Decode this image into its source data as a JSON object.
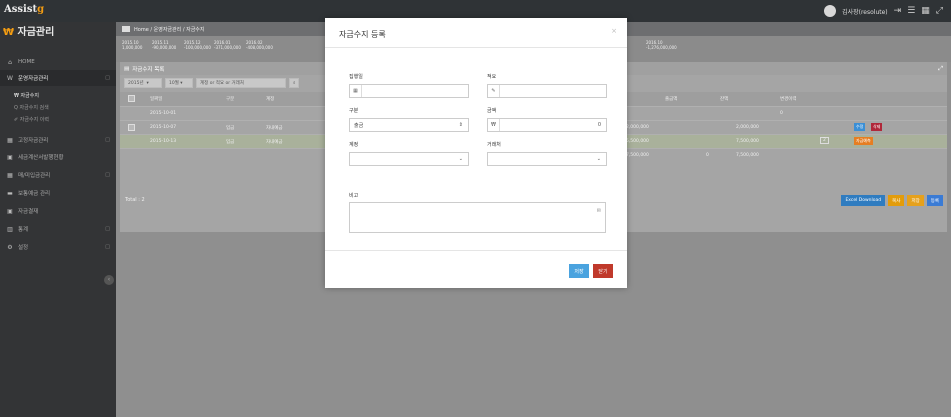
{
  "app": {
    "logo_main": "Assist",
    "logo_accent": "g",
    "user": "김사장(resolute)"
  },
  "sidebar": {
    "title_icon": "₩",
    "title": "자금관리",
    "items": [
      {
        "icon": "home-icon",
        "label": "HOME"
      },
      {
        "icon": "won-icon",
        "label": "운영자금관리",
        "arrow": "□"
      },
      {
        "icon": "calendar-icon",
        "label": "고정자금관리",
        "arrow": "□"
      },
      {
        "icon": "receipt-icon",
        "label": "세금계산서발행현황"
      },
      {
        "icon": "calendar-icon",
        "label": "매/미입금관리",
        "arrow": "□"
      },
      {
        "icon": "deposit-icon",
        "label": "보통예금 관리"
      },
      {
        "icon": "bank-icon",
        "label": "자금결재"
      },
      {
        "icon": "chart-icon",
        "label": "통계",
        "arrow": "□"
      },
      {
        "icon": "settings-icon",
        "label": "설정",
        "arrow": "□"
      }
    ],
    "subitems": [
      {
        "label": "₩ 자금수지"
      },
      {
        "label": "Q 자금수지 검색"
      },
      {
        "label": "✐ 자금수지 이력"
      }
    ]
  },
  "breadcrumb": {
    "text": "Home / 운영자금관리 / 자금수지"
  },
  "stats": [
    {
      "period": "2015.10",
      "amount": "1,000,000"
    },
    {
      "period": "2015.11",
      "amount": "-90,000,000"
    },
    {
      "period": "2015.12",
      "amount": "-100,000,000"
    },
    {
      "period": "2016.01",
      "amount": "-371,000,000"
    },
    {
      "period": "2016.02",
      "amount": "-408,000,000"
    },
    {
      "period": "2016.10",
      "amount": "-1,276,000,000"
    }
  ],
  "panel": {
    "title": "자금수지 목록",
    "year": "2015년",
    "month": "10월",
    "search_placeholder": "계정 or 적요 or 거래처",
    "columns": [
      "일짜일",
      "구분",
      "계정",
      "출금액",
      "잔액",
      "변경이력"
    ],
    "rows": [
      {
        "date": "2015-10-01",
        "type": "",
        "account": "",
        "out": "",
        "balance": "0",
        "history": ""
      },
      {
        "date": "2015-10-07",
        "type": "입금",
        "account": "자내예금",
        "out": "",
        "in_amount": "2,000,000",
        "balance": "2,000,000",
        "history": "",
        "buttons": [
          "수정",
          "삭제"
        ]
      },
      {
        "date": "2015-10-13",
        "type": "입금",
        "account": "자내예금",
        "out": "",
        "in_amount": "5,500,000",
        "balance": "7,500,000",
        "history": "2",
        "buttons": [
          "자금예측"
        ]
      }
    ],
    "sum_row": {
      "in": "7,500,000",
      "out": "0",
      "balance": "7,500,000"
    },
    "total": "Total : 2",
    "actions": [
      "Excel Download",
      "복사",
      "저장",
      "등록"
    ]
  },
  "modal": {
    "title": "자금수지 등록",
    "close": "×",
    "fields": {
      "date_label": "집행일",
      "memo_label": "적요",
      "type_label": "구분",
      "type_value": "출금",
      "amount_label": "금액",
      "amount_prefix": "₩",
      "amount_value": "0",
      "account_label": "계정",
      "vendor_label": "거래처",
      "note_label": "비고"
    },
    "save": "저장",
    "close_btn": "닫기"
  },
  "colors": {
    "save": "#4aa3df",
    "close": "#c0392b",
    "edit": "#3a8fd6",
    "delete": "#b0283a",
    "forecast": "#e67e22",
    "excel": "#2f7cc0",
    "copy": "#e39c0a",
    "store": "#e6a11c",
    "register": "#3a7bd5"
  }
}
